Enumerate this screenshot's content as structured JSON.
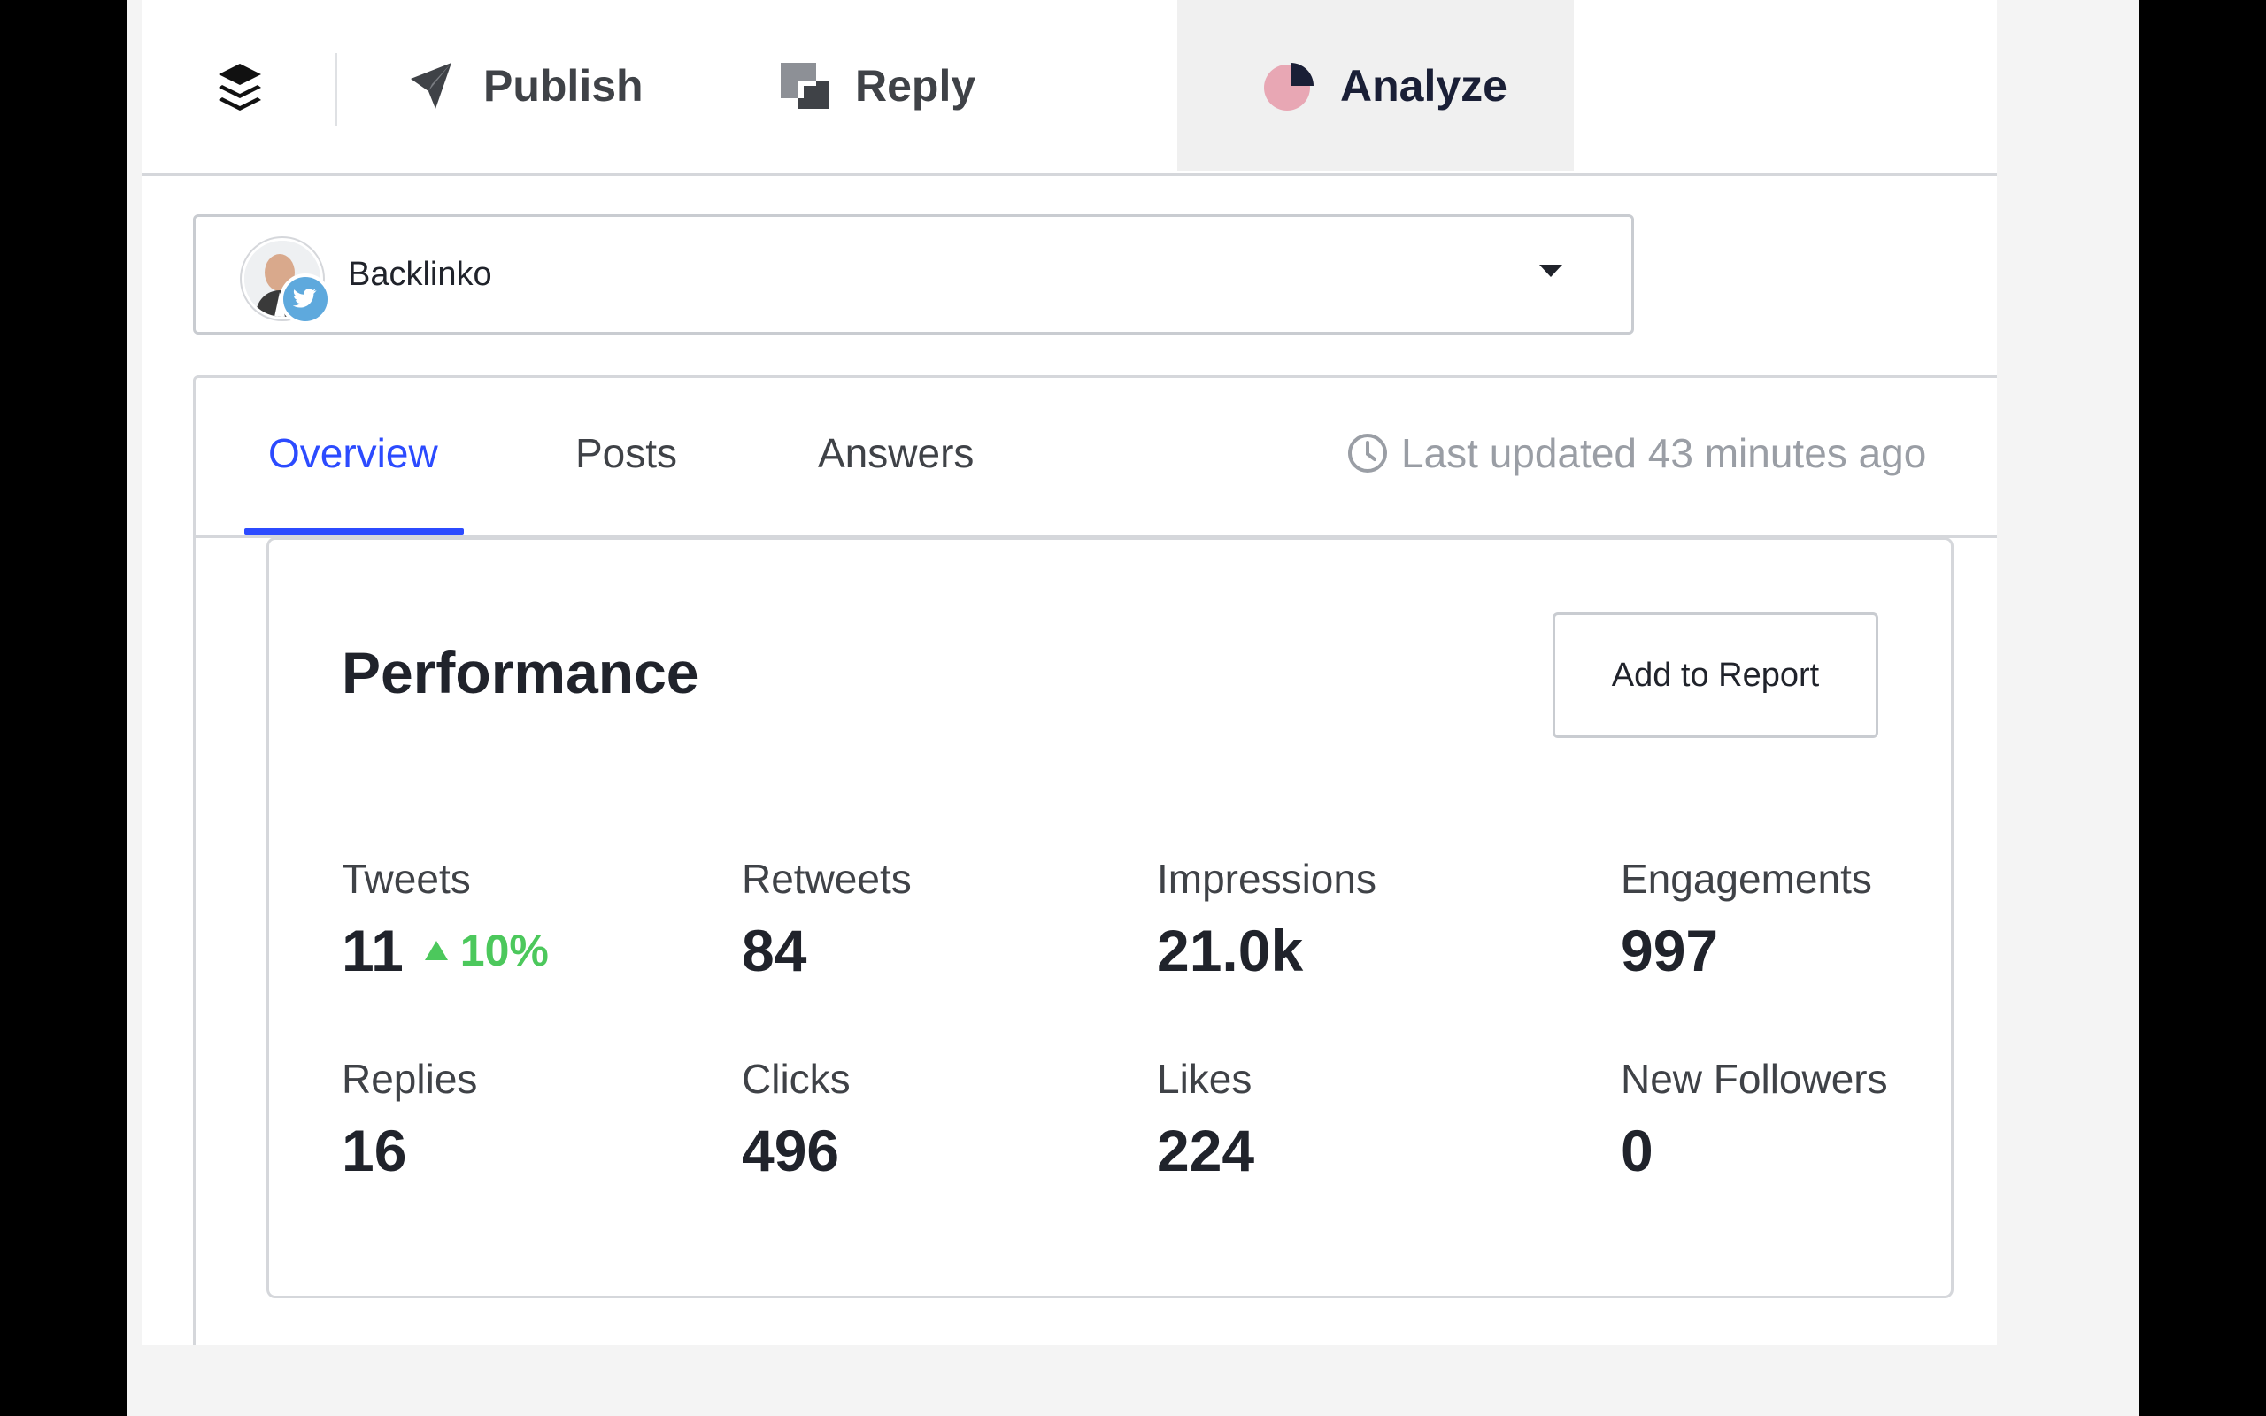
{
  "nav": {
    "items": [
      {
        "label": "Publish",
        "icon": "publish-icon"
      },
      {
        "label": "Reply",
        "icon": "reply-icon"
      },
      {
        "label": "Analyze",
        "icon": "analyze-pie-icon",
        "active": true
      }
    ]
  },
  "profile": {
    "name": "Backlinko",
    "network_icon": "twitter-icon"
  },
  "tabs": {
    "items": [
      {
        "label": "Overview",
        "active": true
      },
      {
        "label": "Posts"
      },
      {
        "label": "Answers"
      }
    ],
    "updated_text": "Last updated 43 minutes ago"
  },
  "performance": {
    "title": "Performance",
    "add_report_label": "Add to Report",
    "metrics": [
      {
        "label": "Tweets",
        "value": "11",
        "change": "10%",
        "trend": "up"
      },
      {
        "label": "Retweets",
        "value": "84"
      },
      {
        "label": "Impressions",
        "value": "21.0k"
      },
      {
        "label": "Engagements",
        "value": "997"
      },
      {
        "label": "Replies",
        "value": "16"
      },
      {
        "label": "Clicks",
        "value": "496"
      },
      {
        "label": "Likes",
        "value": "224"
      },
      {
        "label": "New Followers",
        "value": "0"
      }
    ]
  },
  "colors": {
    "accent": "#2c4bff",
    "positive": "#4cc85c",
    "muted_text": "#9a9ea5",
    "twitter": "#5ea9dd",
    "analyze_icon": "#e8a7b4"
  }
}
